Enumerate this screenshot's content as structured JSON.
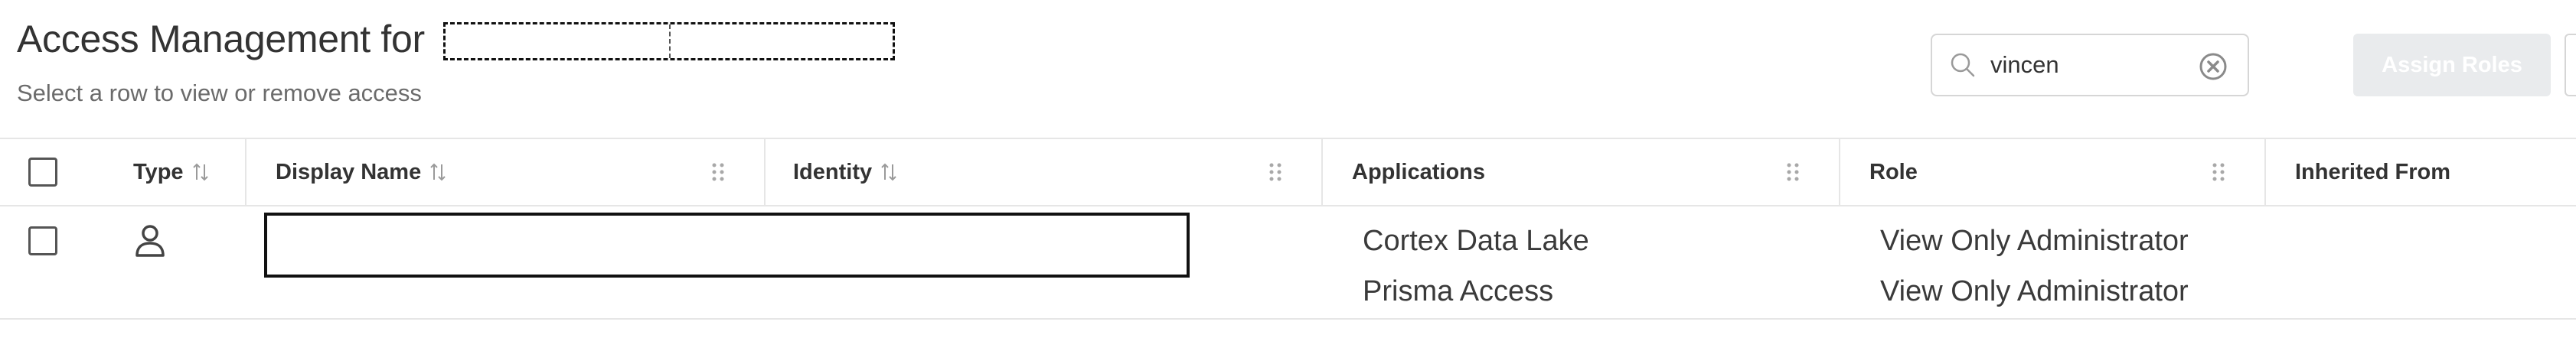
{
  "header": {
    "title": "Access Management for",
    "subtitle": "Select a row to view or remove access"
  },
  "search": {
    "value": "vincen"
  },
  "actions": {
    "assign_roles_label": "Assign Roles"
  },
  "table": {
    "columns": [
      "Type",
      "Display Name",
      "Identity",
      "Applications",
      "Role",
      "Inherited From"
    ],
    "rows": [
      {
        "type_icon": "user-icon",
        "display_name": "",
        "identity": "",
        "entries": [
          {
            "application": "Cortex Data Lake",
            "role": "View Only Administrator"
          },
          {
            "application": "Prisma Access",
            "role": "View Only Administrator"
          }
        ],
        "inherited_from": ""
      }
    ]
  },
  "colors": {
    "border": "#e6e6e6",
    "disabled_button": "#e9ebed",
    "text": "#333333",
    "muted_text": "#6b6b6b"
  }
}
